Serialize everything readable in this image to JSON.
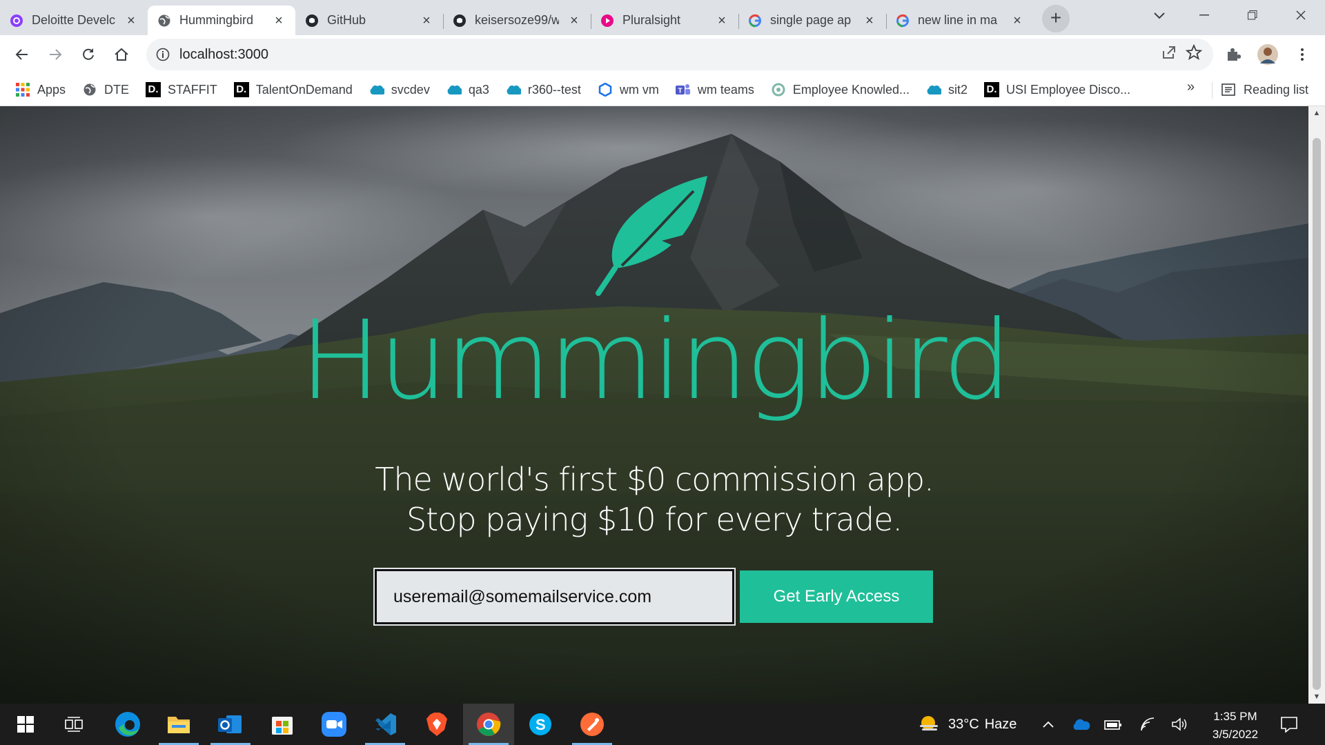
{
  "browser": {
    "tabs": [
      {
        "title": "Deloitte Develc",
        "icon": "deloitte-circle-icon"
      },
      {
        "title": "Hummingbird",
        "icon": "globe-icon"
      },
      {
        "title": "GitHub",
        "icon": "github-icon"
      },
      {
        "title": "keisersoze99/w",
        "icon": "github-icon"
      },
      {
        "title": "Pluralsight",
        "icon": "pluralsight-icon"
      },
      {
        "title": "single page ap",
        "icon": "google-icon"
      },
      {
        "title": "new line in ma",
        "icon": "google-icon"
      }
    ],
    "active_tab_index": 1,
    "url": "localhost:3000",
    "bookmarks": [
      {
        "label": "Apps",
        "icon": "apps-grid-icon"
      },
      {
        "label": "DTE",
        "icon": "globe-icon"
      },
      {
        "label": "STAFFIT",
        "icon": "deloitte-d-icon"
      },
      {
        "label": "TalentOnDemand",
        "icon": "deloitte-d-icon"
      },
      {
        "label": "svcdev",
        "icon": "salesforce-cloud-icon"
      },
      {
        "label": "qa3",
        "icon": "salesforce-cloud-icon"
      },
      {
        "label": "r360--test",
        "icon": "salesforce-cloud-icon"
      },
      {
        "label": "wm vm",
        "icon": "hexagon-icon"
      },
      {
        "label": "wm teams",
        "icon": "teams-icon"
      },
      {
        "label": "Employee Knowled...",
        "icon": "knowledge-icon"
      },
      {
        "label": "sit2",
        "icon": "salesforce-cloud-icon"
      },
      {
        "label": "USI Employee Disco...",
        "icon": "deloitte-d-icon"
      }
    ],
    "bookmarks_overflow": "»",
    "reading_list": "Reading list",
    "deloitte_d": "D."
  },
  "page": {
    "brand": "Hummingbird",
    "tagline_line1": "The world's first $0 commission app.",
    "tagline_line2": "Stop paying $10 for every trade.",
    "email_value": "useremail@somemailservice.com",
    "cta_label": "Get Early Access",
    "accent_color": "#1fbf99"
  },
  "taskbar": {
    "apps": [
      "windows-start-icon",
      "task-view-icon",
      "edge-icon",
      "file-explorer-icon",
      "outlook-icon",
      "microsoft-store-icon",
      "zoom-icon",
      "vscode-icon",
      "brave-icon",
      "chrome-icon",
      "skype-icon",
      "postman-icon"
    ],
    "weather_temp": "33°C",
    "weather_desc": "Haze",
    "time": "1:35 PM",
    "date": "3/5/2022"
  }
}
